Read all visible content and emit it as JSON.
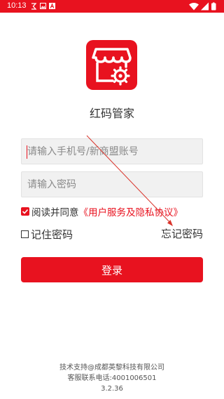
{
  "status_bar": {
    "time": "10:13",
    "icons": [
      "notification-icon",
      "image-icon",
      "a-icon"
    ],
    "right_icons": [
      "wifi-icon",
      "signal-icon",
      "battery-icon"
    ],
    "background_color": "#e8121f"
  },
  "app": {
    "logo_icon": "store-settings-icon",
    "name": "红码管家",
    "accent_color": "#e8121f"
  },
  "form": {
    "account_placeholder": "请输入手机号/新商盟账号",
    "account_value": "",
    "password_placeholder": "请输入密码",
    "password_value": ""
  },
  "agreement": {
    "checked": true,
    "text": "阅读并同意",
    "link": "《用户服务及隐私协议》"
  },
  "remember": {
    "checked": false,
    "label": "记住密码"
  },
  "forgot_password": "忘记密码",
  "login_button": "登录",
  "footer": {
    "support": "技术支持@成都英黎科技有限公司",
    "phone": "客服联系电话:4001006501",
    "version": "3.2.36"
  }
}
